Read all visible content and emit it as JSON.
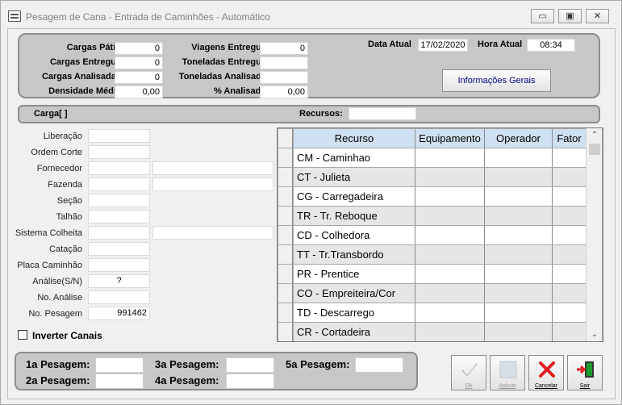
{
  "window": {
    "title": "Pesagem de Cana - Entrada de Caminhões - Automático",
    "min_glyph": "▭",
    "restore_glyph": "▣",
    "close_glyph": "✕"
  },
  "summary": {
    "cargas_patio_label": "Cargas Pátio",
    "cargas_patio_value": "0",
    "cargas_entregue_label": "Cargas Entregue",
    "cargas_entregue_value": "0",
    "cargas_analisadas_label": "Cargas Analisadas",
    "cargas_analisadas_value": "0",
    "densidade_media_label": "Densidade Média",
    "densidade_media_value": "0,00",
    "viagens_entregue_label": "Viagens Entregue",
    "viagens_entregue_value": "0",
    "toneladas_entregue_label": "Toneladas Entregue",
    "toneladas_entregue_value": "",
    "toneladas_analisada_label": "Toneladas Analisada",
    "toneladas_analisada_value": "",
    "pct_analisado_label": "% Analisado",
    "pct_analisado_value": "0,00",
    "data_atual_label": "Data Atual",
    "data_atual_value": "17/02/2020",
    "hora_atual_label": "Hora Atual",
    "hora_atual_value": "08:34",
    "info_button": "Informações Gerais"
  },
  "carga": {
    "label": "Carga[  ]",
    "recursos_label": "Recursos:",
    "recursos_value": ""
  },
  "form": {
    "liberacao": {
      "label": "Liberação",
      "value": ""
    },
    "ordem_corte": {
      "label": "Ordem Corte",
      "value": ""
    },
    "fornecedor": {
      "label": "Fornecedor",
      "value": "",
      "desc": ""
    },
    "fazenda": {
      "label": "Fazenda",
      "value": "",
      "desc": ""
    },
    "secao": {
      "label": "Seção",
      "value": ""
    },
    "talhao": {
      "label": "Talhão",
      "value": ""
    },
    "sistema_colheita": {
      "label": "Sistema Colheita",
      "value": "",
      "desc": ""
    },
    "catacao": {
      "label": "Catação",
      "value": ""
    },
    "placa_caminhao": {
      "label": "Placa Caminhão",
      "value": ""
    },
    "analise_sn": {
      "label": "Análise(S/N)",
      "value": "?"
    },
    "no_analise": {
      "label": "No. Análise",
      "value": ""
    },
    "no_pesagem": {
      "label": "No. Pesagem",
      "value": "991462"
    }
  },
  "grid": {
    "headers": [
      "Recurso",
      "Equipamento",
      "Operador",
      "Fator"
    ],
    "rows": [
      "CM - Caminhao",
      "CT - Julieta",
      "CG - Carregadeira",
      "TR - Tr. Reboque",
      "CD - Colhedora",
      "TT - Tr.Transbordo",
      "PR - Prentice",
      "CO - Empreiteira/Cor",
      "TD - Descarrego",
      "CR - Cortadeira"
    ]
  },
  "inverter_canais": {
    "label": "Inverter Canais",
    "checked": false
  },
  "pesagens": {
    "p1_label": "1a Pesagem:",
    "p1_value": "",
    "p2_label": "2a Pesagem:",
    "p2_value": "",
    "p3_label": "3a Pesagem:",
    "p3_value": "",
    "p4_label": "4a Pesagem:",
    "p4_value": "",
    "p5_label": "5a Pesagem:",
    "p5_value": ""
  },
  "actions": {
    "ok": "Ok",
    "aplicar": "Aplicar",
    "cancelar": "Cancelar",
    "sair": "Sair"
  },
  "colors": {
    "panel": "#c7c7c7",
    "header": "#cfe0f0",
    "cancel_red": "#e02020",
    "sair_green": "#1c9a2c"
  }
}
